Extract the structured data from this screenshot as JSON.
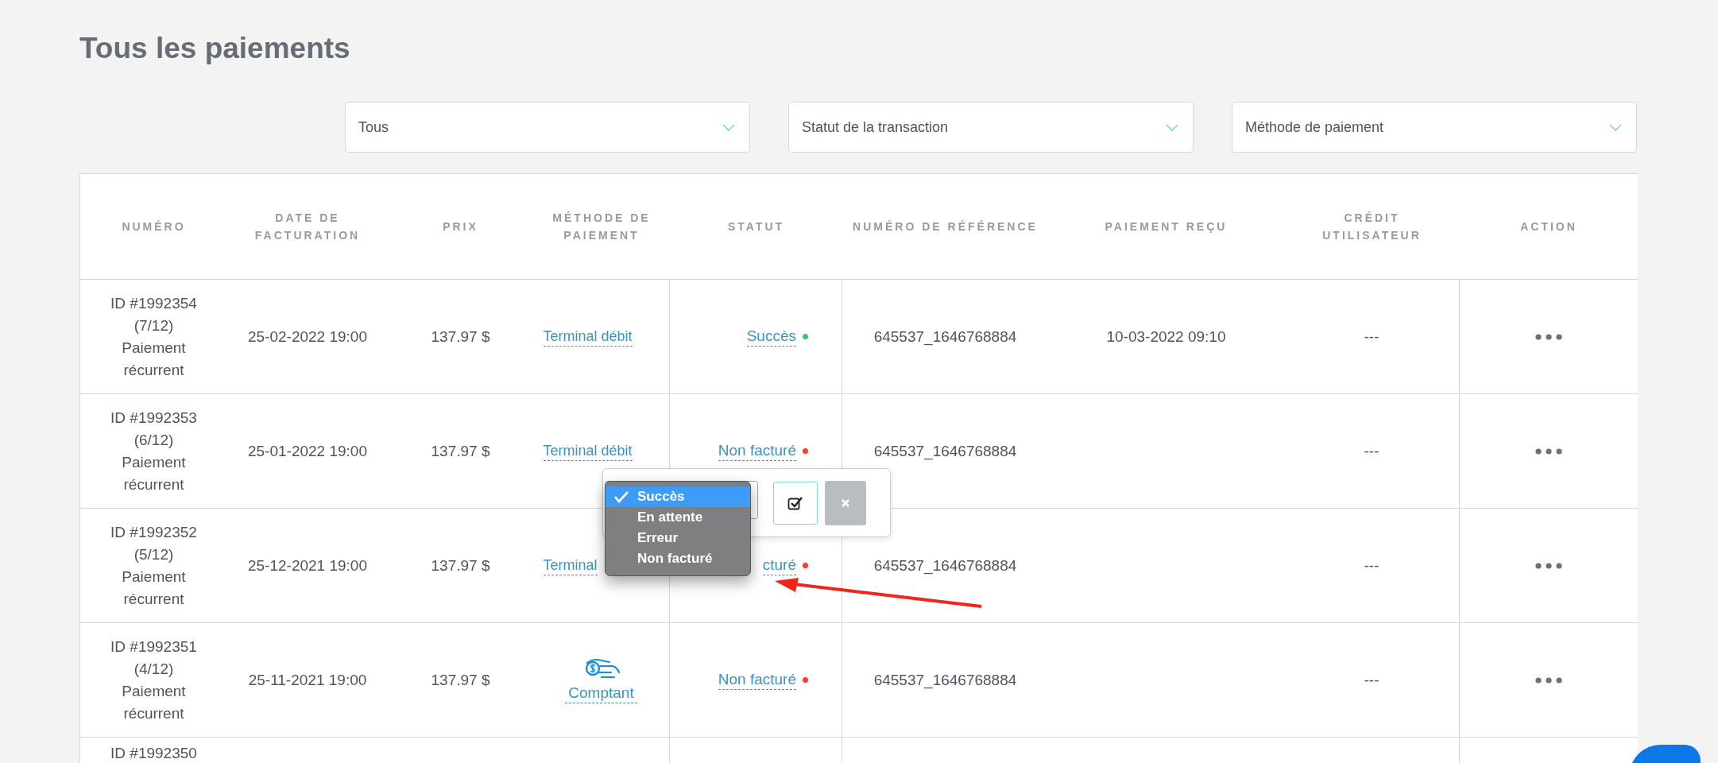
{
  "page": {
    "title": "Tous les paiements"
  },
  "filters": [
    {
      "value": "Tous"
    },
    {
      "value": "Statut de la transaction"
    },
    {
      "value": "Méthode de paiement"
    }
  ],
  "table": {
    "columns": [
      "NUMÉRO",
      "DATE DE FACTURATION",
      "PRIX",
      "MÉTHODE DE PAIEMENT",
      "STATUT",
      "NUMÉRO DE RÉFÉRENCE",
      "PAIEMENT REÇU",
      "CRÉDIT UTILISATEUR",
      "ACTION"
    ],
    "rows": [
      {
        "number": "ID #1992354",
        "installment": "(7/12)",
        "type": "Paiement récurrent",
        "date": "25-02-2022 19:00",
        "price": "137.97 $",
        "method": {
          "kind": "terminal",
          "label": "Terminal débit"
        },
        "status": {
          "label": "Succès",
          "color": "#3cc46b"
        },
        "reference": "645537_1646768884",
        "received": "10-03-2022 09:10",
        "credit": "---"
      },
      {
        "number": "ID #1992353",
        "installment": "(6/12)",
        "type": "Paiement récurrent",
        "date": "25-01-2022 19:00",
        "price": "137.97 $",
        "method": {
          "kind": "terminal",
          "label": "Terminal débit"
        },
        "status": {
          "label": "Non facturé",
          "color": "#f0412f"
        },
        "reference": "645537_1646768884",
        "credit": "---"
      },
      {
        "number": "ID #1992352",
        "installment": "(5/12)",
        "type": "Paiement récurrent",
        "date": "25-12-2021 19:00",
        "price": "137.97 $",
        "method": {
          "kind": "terminal",
          "label": "Terminal"
        },
        "status": {
          "label": "cturé",
          "color": "#f0412f"
        },
        "reference": "645537_1646768884",
        "credit": "---"
      },
      {
        "number": "ID #1992351",
        "installment": "(4/12)",
        "type": "Paiement récurrent",
        "date": "25-11-2021 19:00",
        "price": "137.97 $",
        "method": {
          "kind": "cash",
          "label": "Comptant"
        },
        "status": {
          "label": "Non facturé",
          "color": "#f0412f"
        },
        "reference": "645537_1646768884",
        "credit": "---"
      },
      {
        "number": "ID #1992350"
      }
    ]
  },
  "status_editor": {
    "options": [
      {
        "label": "Succès",
        "selected": true
      },
      {
        "label": "En attente",
        "selected": false
      },
      {
        "label": "Erreur",
        "selected": false
      },
      {
        "label": "Non facturé",
        "selected": false
      }
    ]
  }
}
